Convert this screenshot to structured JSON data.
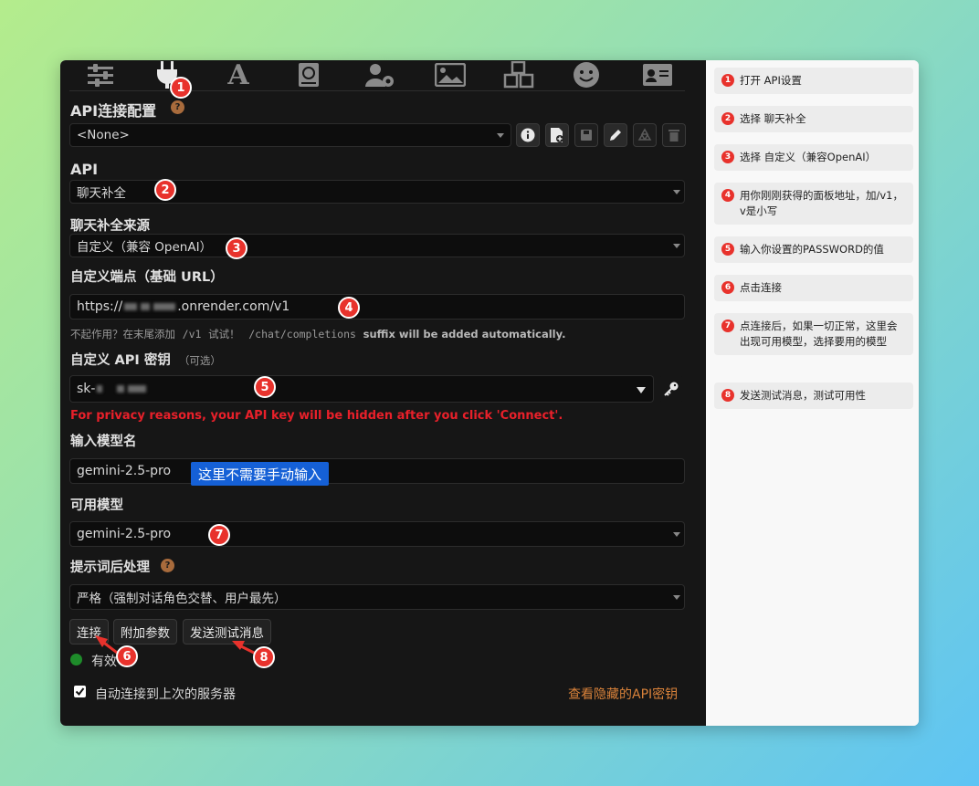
{
  "nav_icons": [
    "sliders-icon",
    "plug-icon",
    "font-icon",
    "book-icon",
    "user-gear-icon",
    "image-icon",
    "cubes-icon",
    "face-icon",
    "id-card-icon"
  ],
  "conn_profile": {
    "title": "API连接配置",
    "help": "?",
    "value": "<None>"
  },
  "api": {
    "label": "API",
    "value": "聊天补全"
  },
  "source": {
    "label": "聊天补全来源",
    "value": "自定义（兼容 OpenAI）"
  },
  "endpoint": {
    "label": "自定义端点（基础 URL）",
    "prefix": "https://",
    "suffix": ".onrender.com/v1",
    "hint_prefix": "不起作用？在末尾添加",
    "hint_code1": "/v1",
    "hint_mid": "试试！",
    "hint_code2": "/chat/completions",
    "hint_bold": "suffix will be added automatically."
  },
  "apikey": {
    "label": "自定义 API 密钥",
    "optional": "（可选）",
    "value_prefix": "sk-",
    "warning": "For privacy reasons, your API key will be hidden after you click 'Connect'."
  },
  "model_input": {
    "label": "输入模型名",
    "value": "gemini-2.5-pro",
    "note": "这里不需要手动输入"
  },
  "available": {
    "label": "可用模型",
    "value": "gemini-2.5-pro"
  },
  "postproc": {
    "label": "提示词后处理",
    "help": "?",
    "value": "严格（强制对话角色交替、用户最先）"
  },
  "buttons": {
    "connect": "连接",
    "extra": "附加参数",
    "test": "发送测试消息"
  },
  "status": {
    "text": "有效",
    "color": "#1e8c2a"
  },
  "auto_connect": {
    "label": "自动连接到上次的服务器",
    "checked": true
  },
  "view_hidden": "查看隐藏的API密钥",
  "badges": [
    "1",
    "2",
    "3",
    "4",
    "5",
    "6",
    "7",
    "8"
  ],
  "steps": [
    {
      "num": "1",
      "text": "打开 API设置"
    },
    {
      "num": "2",
      "text": "选择 聊天补全"
    },
    {
      "num": "3",
      "text": "选择 自定义（兼容OpenAI）"
    },
    {
      "num": "4",
      "text": "用你刚刚获得的面板地址，加/v1，v是小写"
    },
    {
      "num": "5",
      "text": "输入你设置的PASSWORD的值"
    },
    {
      "num": "6",
      "text": "点击连接"
    },
    {
      "num": "7",
      "text": "点连接后，如果一切正常，这里会出现可用模型，选择要用的模型"
    },
    {
      "num": "8",
      "text": "发送测试消息，测试可用性"
    }
  ],
  "colors": {
    "badge": "#e8322c",
    "warning": "#e8202a",
    "link": "#d9823a",
    "note_bg": "#1560d6",
    "panel": "#161616"
  }
}
